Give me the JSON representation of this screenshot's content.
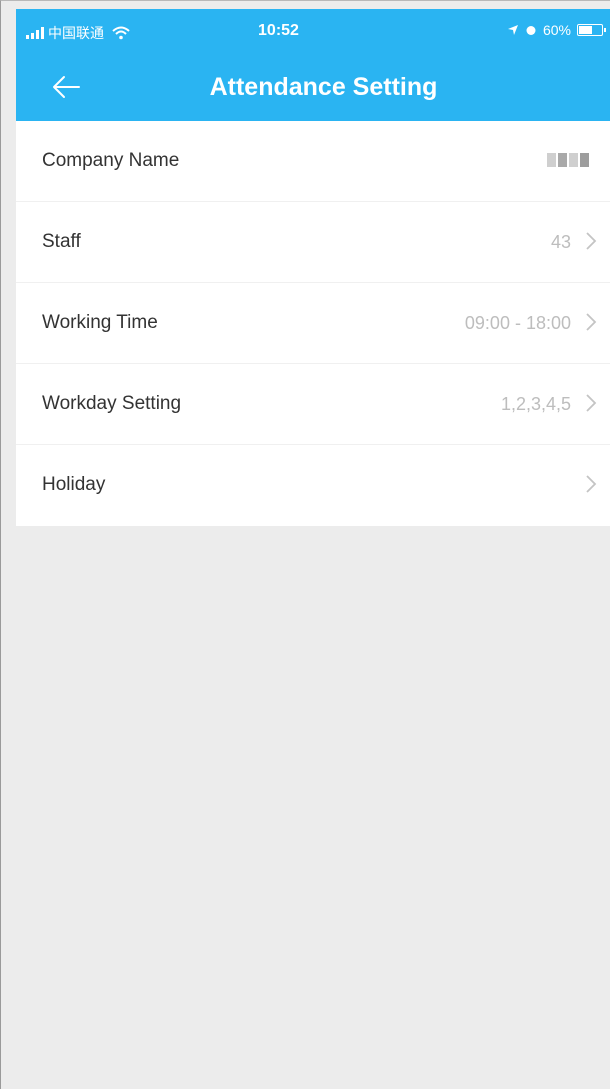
{
  "status_bar": {
    "carrier": "中国联通",
    "time": "10:52",
    "battery": "60%",
    "battery_level": 0.6
  },
  "nav": {
    "title": "Attendance Setting",
    "back_icon": "arrow-left-icon"
  },
  "settings": [
    {
      "label": "Company Name",
      "value": ""
    },
    {
      "label": "Staff",
      "value": "43"
    },
    {
      "label": "Working Time",
      "value": "09:00 - 18:00"
    },
    {
      "label": "Workday Setting",
      "value": "1,2,3,4,5"
    },
    {
      "label": "Holiday",
      "value": ""
    }
  ],
  "colors": {
    "header_bg": "#2ab4f2",
    "page_bg": "#ececec",
    "value_text": "#bdbdbd"
  }
}
